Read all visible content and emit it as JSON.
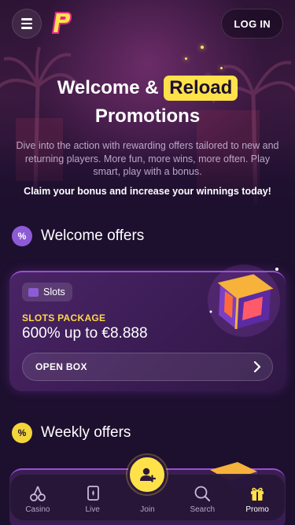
{
  "header": {
    "login_label": "LOG IN",
    "logo_letter": "P"
  },
  "hero": {
    "title_prefix": "Welcome &",
    "title_highlight": "Reload",
    "title_suffix": "Promotions",
    "description": "Dive into the action with rewarding offers tailored to new and returning players. More fun, more wins, more often. Play smart, play with a bonus.",
    "claim": "Claim your bonus and increase your winnings today!"
  },
  "welcome": {
    "title": "Welcome offers",
    "badge": "%",
    "card": {
      "chip_label": "Slots",
      "package_label": "SLOTS PACKAGE",
      "package_amount": "600% up to €8.888",
      "button_label": "OPEN BOX"
    }
  },
  "weekly": {
    "title": "Weekly offers",
    "badge": "%"
  },
  "nav": {
    "items": [
      {
        "label": "Casino",
        "icon": "cherries-icon"
      },
      {
        "label": "Live",
        "icon": "cards-icon"
      },
      {
        "label": "Join",
        "icon": "add-user-icon"
      },
      {
        "label": "Search",
        "icon": "search-icon"
      },
      {
        "label": "Promo",
        "icon": "gift-icon"
      }
    ],
    "active": "Promo"
  },
  "colors": {
    "background": "#1d0f2e",
    "accent_yellow": "#ffe24a",
    "card_purple": "#3b1c54",
    "welcome_badge": "#8e5bd6"
  }
}
